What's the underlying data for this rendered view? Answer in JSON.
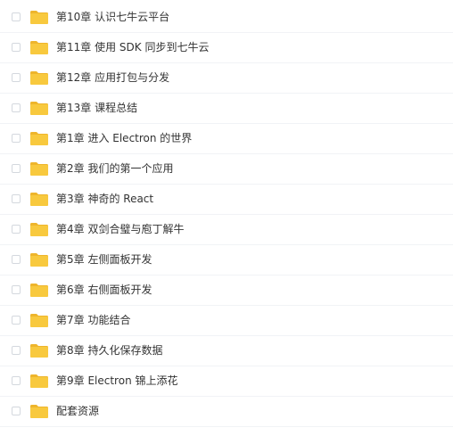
{
  "file_list": {
    "items": [
      {
        "name": "第10章 认识七牛云平台",
        "icon": "folder-icon",
        "checked": false
      },
      {
        "name": "第11章 使用 SDK 同步到七牛云",
        "icon": "folder-icon",
        "checked": false
      },
      {
        "name": "第12章 应用打包与分发",
        "icon": "folder-icon",
        "checked": false
      },
      {
        "name": "第13章 课程总结",
        "icon": "folder-icon",
        "checked": false
      },
      {
        "name": "第1章 进入 Electron 的世界",
        "icon": "folder-icon",
        "checked": false
      },
      {
        "name": "第2章 我们的第一个应用",
        "icon": "folder-icon",
        "checked": false
      },
      {
        "name": "第3章 神奇的 React",
        "icon": "folder-icon",
        "checked": false
      },
      {
        "name": "第4章 双剑合璧与庖丁解牛",
        "icon": "folder-icon",
        "checked": false
      },
      {
        "name": "第5章 左侧面板开发",
        "icon": "folder-icon",
        "checked": false
      },
      {
        "name": "第6章 右侧面板开发",
        "icon": "folder-icon",
        "checked": false
      },
      {
        "name": "第7章 功能结合",
        "icon": "folder-icon",
        "checked": false
      },
      {
        "name": "第8章 持久化保存数据",
        "icon": "folder-icon",
        "checked": false
      },
      {
        "name": "第9章 Electron 锦上添花",
        "icon": "folder-icon",
        "checked": false
      },
      {
        "name": "配套资源",
        "icon": "folder-icon",
        "checked": false
      }
    ]
  },
  "colors": {
    "folder_body": "#f8c93e",
    "folder_tab": "#eeb52c",
    "text": "#333333",
    "checkbox_border": "#d4d8de",
    "row_divider": "#f1f3f6"
  }
}
